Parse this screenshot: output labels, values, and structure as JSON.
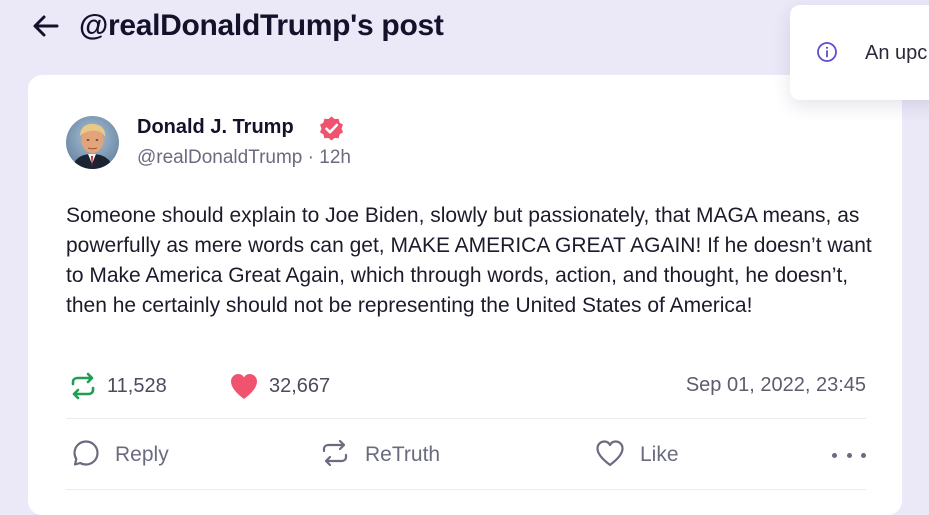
{
  "header": {
    "title": "@realDonaldTrump's post"
  },
  "post": {
    "author": {
      "display_name": "Donald J. Trump",
      "handle": "@realDonaldTrump",
      "age": "12h"
    },
    "text": "Someone should explain to Joe Biden, slowly but passionately, that MAGA means, as powerfully as mere words can get, MAKE AMERICA GREAT AGAIN! If he doesn’t want to Make America Great Again, which through words, action, and thought, he doesn’t, then he certainly should not be representing the United States of America!",
    "retruths_count": "11,528",
    "likes_count": "32,667",
    "timestamp": "Sep 01, 2022, 23:45"
  },
  "actions": {
    "reply_label": "Reply",
    "retruth_label": "ReTruth",
    "like_label": "Like"
  },
  "toast": {
    "text": "An upc"
  },
  "colors": {
    "background": "#ebe9f8",
    "verified": "#f0536e",
    "retruth": "#1f9d55",
    "like": "#f0536e"
  }
}
